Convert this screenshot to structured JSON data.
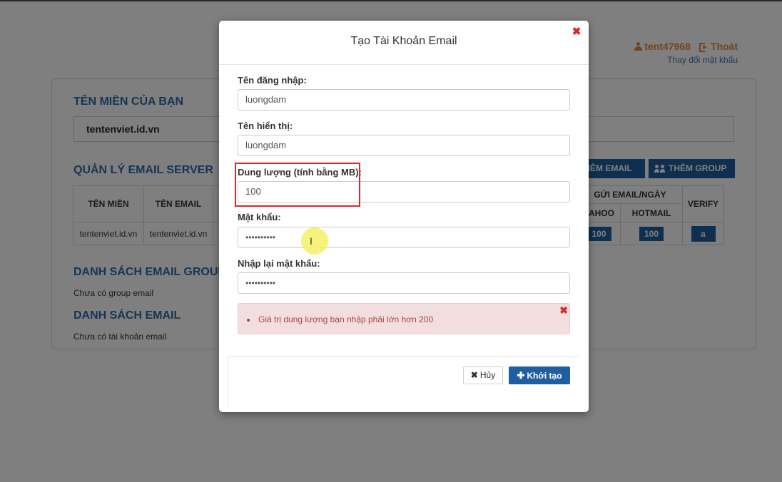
{
  "header": {
    "username": "tent47968",
    "logout_label": "Thoát",
    "change_password_label": "Thay đổi mật khẩu"
  },
  "page": {
    "domain_section_title": "TÊN MIỀN CỦA BẠN",
    "domain_value": "tentenviet.id.vn",
    "server_section_title": "QUẢN LÝ EMAIL SERVER",
    "add_email_label": "THÊM EMAIL",
    "add_group_label": "THÊM GROUP",
    "table": {
      "col_domain": "TÊN MIỀN",
      "col_email": "TÊN EMAIL",
      "col_send_per_day": "GỬI EMAIL/NGÀY",
      "col_yahoo": "YAHOO",
      "col_hotmail": "HOTMAIL",
      "col_verify": "VERIFY",
      "row": {
        "domain": "tentenviet.id.vn",
        "email": "tentenviet.id.vn",
        "yahoo": "100",
        "hotmail": "100",
        "verify_icon": "a"
      }
    },
    "group_section_title": "DANH SÁCH EMAIL GROUP",
    "group_empty": "Chưa có group email",
    "email_section_title": "DANH SÁCH EMAIL",
    "email_empty": "Chưa có tài khoản email"
  },
  "modal": {
    "title": "Tạo Tài Khoản Email",
    "close_icon": "✖",
    "fields": {
      "username_label": "Tên đăng nhập:",
      "username_value": "luongdam",
      "display_label": "Tên hiển thị:",
      "display_value": "luongdam",
      "quota_label": "Dung lượng (tính bằng MB):",
      "quota_value": "100",
      "password_label": "Mật khẩu:",
      "password_value": "••••••••••",
      "password_confirm_label": "Nhập lại mật khẩu:",
      "password_confirm_value": "••••••••••"
    },
    "error_message": "Giá trị dung lượng bạn nhập phải lớn hơn 200",
    "error_close": "✖",
    "cancel_label": "Hủy",
    "cancel_icon": "✖",
    "create_label": "Khởi tạo",
    "create_icon": "✚"
  },
  "colors": {
    "accent": "#1f5ea1",
    "highlight": "#e0262a",
    "user_orange": "#e8843a"
  }
}
